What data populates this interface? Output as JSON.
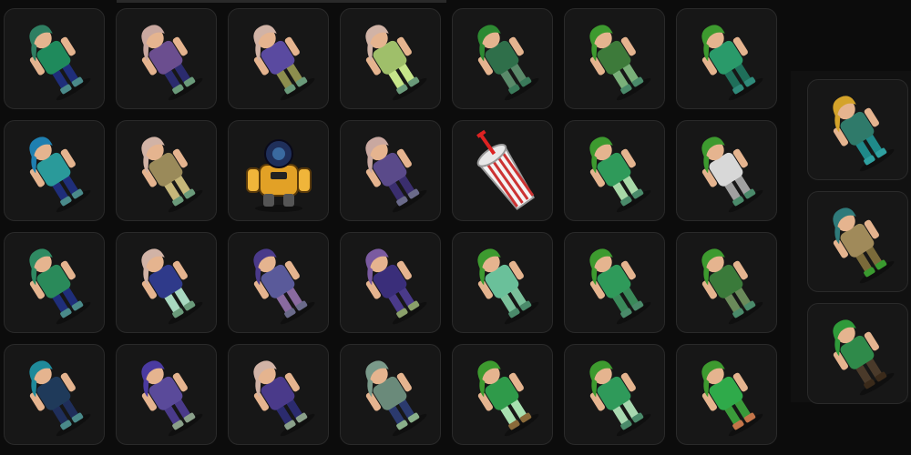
{
  "grid": {
    "tiles": [
      {
        "icon": "avatar-teal-hat-icon",
        "c": {
          "hair": "#2f7f62",
          "skin": "#e5b48f",
          "top": "#1f8a5c",
          "pants": "#1f2e7a",
          "shoes": "#4a8a8a"
        }
      },
      {
        "icon": "avatar-pink-hair-purple-icon",
        "c": {
          "hair": "#c9a8a0",
          "skin": "#e5b48f",
          "top": "#6b4e8f",
          "pants": "#2b2b6e",
          "shoes": "#6a9a7a"
        }
      },
      {
        "icon": "avatar-pink-hair-blue-icon",
        "c": {
          "hair": "#d1b3a6",
          "skin": "#e5b48f",
          "top": "#5a4aa0",
          "pants": "#8d8e4e",
          "shoes": "#6a9a7a"
        }
      },
      {
        "icon": "avatar-pink-hair-lime-icon",
        "c": {
          "hair": "#d1b3a6",
          "skin": "#e5b48f",
          "top": "#9fbf6a",
          "pants": "#c6e58a",
          "shoes": "#6a9a7a"
        }
      },
      {
        "icon": "avatar-green-hair-icon",
        "c": {
          "hair": "#2d8a32",
          "skin": "#e5b48f",
          "top": "#2f6f4a",
          "pants": "#5a8a6a",
          "shoes": "#3a7a5a"
        }
      },
      {
        "icon": "avatar-green-hair-bear-icon",
        "c": {
          "hair": "#3d9a2f",
          "skin": "#e5b48f",
          "top": "#3d7a3a",
          "pants": "#7ab07a",
          "shoes": "#4a8a6a"
        }
      },
      {
        "icon": "avatar-green-hair-teal-icon",
        "c": {
          "hair": "#3d9a2f",
          "skin": "#e5b48f",
          "top": "#2a9a6a",
          "pants": "#1f6f5a",
          "shoes": "#2f8a7a"
        }
      },
      {
        "icon": "avatar-blue-hair-icon",
        "c": {
          "hair": "#1f7fb0",
          "skin": "#e5b48f",
          "top": "#2a9a9a",
          "pants": "#1f2e7a",
          "shoes": "#4a8a8a"
        }
      },
      {
        "icon": "avatar-pink-hair-olive-icon",
        "c": {
          "hair": "#d1b3a6",
          "skin": "#e5b48f",
          "top": "#9a8a5a",
          "pants": "#c6b77a",
          "shoes": "#6a9a7a"
        }
      },
      {
        "icon": "robot-mech-icon",
        "c": {
          "hair": "#1f2f5a",
          "skin": "#9ab",
          "top": "#e2a126",
          "pants": "#f0b53a",
          "shoes": "#333"
        }
      },
      {
        "icon": "avatar-pink-hair-violet-icon",
        "c": {
          "hair": "#c9a8a0",
          "skin": "#e5b48f",
          "top": "#5a4a8a",
          "pants": "#3a2e6e",
          "shoes": "#6a6a8a"
        }
      },
      {
        "icon": "milkshake-cup-icon",
        "c": {
          "hair": "#d22",
          "skin": "#fff",
          "top": "#c33",
          "pants": "#fff",
          "shoes": "#ddd"
        }
      },
      {
        "icon": "avatar-green-pigtails-icon",
        "c": {
          "hair": "#3d9a2f",
          "skin": "#e5b48f",
          "top": "#2f9a5a",
          "pants": "#a8d8a8",
          "shoes": "#4a8a6a"
        }
      },
      {
        "icon": "avatar-green-hair-white-icon",
        "c": {
          "hair": "#3d9a2f",
          "skin": "#e5b48f",
          "top": "#d8d8d8",
          "pants": "#a0a0a0",
          "shoes": "#4a8a6a"
        }
      },
      {
        "icon": "avatar-teal-cap-icon",
        "c": {
          "hair": "#2f8a62",
          "skin": "#e5b48f",
          "top": "#2a8a5a",
          "pants": "#1f2e7a",
          "shoes": "#4a8a8a"
        }
      },
      {
        "icon": "avatar-pink-hair-navy-icon",
        "c": {
          "hair": "#d1b3a6",
          "skin": "#e5b48f",
          "top": "#2f3a8a",
          "pants": "#a8d8c0",
          "shoes": "#6a9a7a"
        }
      },
      {
        "icon": "avatar-purple-hat-icon",
        "c": {
          "hair": "#4a3a8a",
          "skin": "#e5b48f",
          "top": "#5a5a9a",
          "pants": "#8a6aa0",
          "shoes": "#6a6a8a"
        }
      },
      {
        "icon": "avatar-purple-suit-icon",
        "c": {
          "hair": "#7a5aa0",
          "skin": "#e5b48f",
          "top": "#3a2e7a",
          "pants": "#4a3a8a",
          "shoes": "#8aa06a"
        }
      },
      {
        "icon": "avatar-green-hair-mint-icon",
        "c": {
          "hair": "#3d9a2f",
          "skin": "#e5b48f",
          "top": "#6ac09a",
          "pants": "#7ac09a",
          "shoes": "#4a8a6a"
        }
      },
      {
        "icon": "avatar-green-hair-dress-icon",
        "c": {
          "hair": "#3d9a2f",
          "skin": "#e5b48f",
          "top": "#2f9a5a",
          "pants": "#3a8a5a",
          "shoes": "#4a8a6a"
        }
      },
      {
        "icon": "avatar-green-hair-olive-icon",
        "c": {
          "hair": "#3d9a2f",
          "skin": "#e5b48f",
          "top": "#3a7a3a",
          "pants": "#6a8a5a",
          "shoes": "#4a8a6a"
        }
      },
      {
        "icon": "avatar-teal-bun-icon",
        "c": {
          "hair": "#1f8a9a",
          "skin": "#e5b48f",
          "top": "#1f3a5a",
          "pants": "#1f2e5a",
          "shoes": "#4a8a8a"
        }
      },
      {
        "icon": "avatar-violet-hair-icon",
        "c": {
          "hair": "#4a3aa0",
          "skin": "#e5b48f",
          "top": "#5a4a9a",
          "pants": "#4a3a8a",
          "shoes": "#8aa08a"
        }
      },
      {
        "icon": "avatar-pink-hair-skirt-icon",
        "c": {
          "hair": "#d1b3a6",
          "skin": "#e5b48f",
          "top": "#4a3a8a",
          "pants": "#2b2b6e",
          "shoes": "#8aa08a"
        }
      },
      {
        "icon": "avatar-sage-hair-icon",
        "c": {
          "hair": "#7a9a8a",
          "skin": "#e5b48f",
          "top": "#6a8a7a",
          "pants": "#2b3a6e",
          "shoes": "#8ab08a"
        }
      },
      {
        "icon": "avatar-green-apron-icon",
        "c": {
          "hair": "#3d9a2f",
          "skin": "#e5b48f",
          "top": "#2f9a4a",
          "pants": "#a8e0b0",
          "shoes": "#8a6a3a"
        }
      },
      {
        "icon": "avatar-green-gown-icon",
        "c": {
          "hair": "#3d9a2f",
          "skin": "#e5b48f",
          "top": "#2f9a5a",
          "pants": "#a8d8b0",
          "shoes": "#4a8a6a"
        }
      },
      {
        "icon": "avatar-green-bear-icon",
        "c": {
          "hair": "#3d9a2f",
          "skin": "#e5b48f",
          "top": "#2faa4a",
          "pants": "#3a9a3a",
          "shoes": "#c4754a"
        }
      }
    ]
  },
  "side": {
    "tiles": [
      {
        "icon": "avatar-straw-hat-icon",
        "c": {
          "hair": "#d4a32a",
          "skin": "#e5b48f",
          "top": "#2f7a6a",
          "pants": "#1f8a8a",
          "shoes": "#2fa0a0"
        }
      },
      {
        "icon": "avatar-explorer-icon",
        "c": {
          "hair": "#2f7a7a",
          "skin": "#e5b48f",
          "top": "#a08a5a",
          "pants": "#7a6a3a",
          "shoes": "#3a9a2f"
        }
      },
      {
        "icon": "avatar-green-cap-icon",
        "c": {
          "hair": "#2f9a3a",
          "skin": "#e5b48f",
          "top": "#2f8a4a",
          "pants": "#4a3a2a",
          "shoes": "#3a2a1a"
        }
      }
    ]
  }
}
